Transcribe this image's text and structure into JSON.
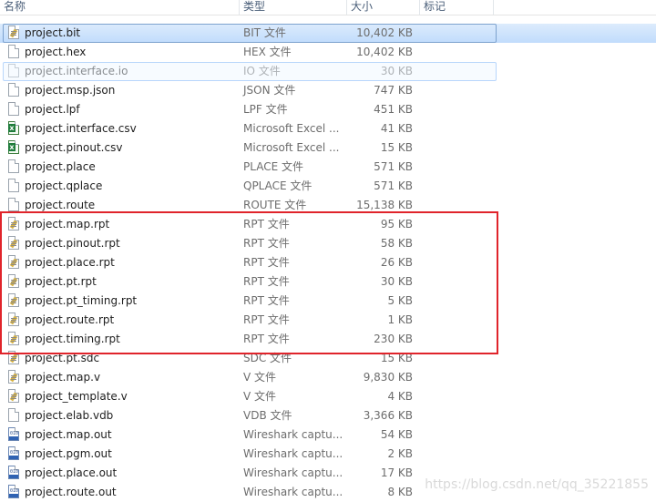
{
  "columns": {
    "name": "名称",
    "type": "类型",
    "size": "大小",
    "tags": "标记"
  },
  "files": [
    {
      "name": "project.bit",
      "type": "BIT 文件",
      "size": "10,402 KB",
      "icon": "document-icon"
    },
    {
      "name": "project.hex",
      "type": "HEX 文件",
      "size": "10,402 KB",
      "icon": "blank-file-icon"
    },
    {
      "name": "project.interface.io",
      "type": "IO 文件",
      "size": "30 KB",
      "icon": "blank-file-icon"
    },
    {
      "name": "project.msp.json",
      "type": "JSON 文件",
      "size": "747 KB",
      "icon": "blank-file-icon"
    },
    {
      "name": "project.lpf",
      "type": "LPF 文件",
      "size": "451 KB",
      "icon": "blank-file-icon"
    },
    {
      "name": "project.interface.csv",
      "type": "Microsoft Excel ...",
      "size": "41 KB",
      "icon": "excel-file-icon"
    },
    {
      "name": "project.pinout.csv",
      "type": "Microsoft Excel ...",
      "size": "15 KB",
      "icon": "excel-file-icon"
    },
    {
      "name": "project.place",
      "type": "PLACE 文件",
      "size": "571 KB",
      "icon": "blank-file-icon"
    },
    {
      "name": "project.qplace",
      "type": "QPLACE 文件",
      "size": "571 KB",
      "icon": "blank-file-icon"
    },
    {
      "name": "project.route",
      "type": "ROUTE 文件",
      "size": "15,138 KB",
      "icon": "blank-file-icon"
    },
    {
      "name": "project.map.rpt",
      "type": "RPT 文件",
      "size": "95 KB",
      "icon": "document-icon"
    },
    {
      "name": "project.pinout.rpt",
      "type": "RPT 文件",
      "size": "58 KB",
      "icon": "document-icon"
    },
    {
      "name": "project.place.rpt",
      "type": "RPT 文件",
      "size": "26 KB",
      "icon": "document-icon"
    },
    {
      "name": "project.pt.rpt",
      "type": "RPT 文件",
      "size": "30 KB",
      "icon": "document-icon"
    },
    {
      "name": "project.pt_timing.rpt",
      "type": "RPT 文件",
      "size": "5 KB",
      "icon": "document-icon"
    },
    {
      "name": "project.route.rpt",
      "type": "RPT 文件",
      "size": "1 KB",
      "icon": "document-icon"
    },
    {
      "name": "project.timing.rpt",
      "type": "RPT 文件",
      "size": "230 KB",
      "icon": "document-icon"
    },
    {
      "name": "project.pt.sdc",
      "type": "SDC 文件",
      "size": "15 KB",
      "icon": "document-icon"
    },
    {
      "name": "project.map.v",
      "type": "V 文件",
      "size": "9,830 KB",
      "icon": "document-icon"
    },
    {
      "name": "project_template.v",
      "type": "V 文件",
      "size": "4 KB",
      "icon": "document-icon"
    },
    {
      "name": "project.elab.vdb",
      "type": "VDB 文件",
      "size": "3,366 KB",
      "icon": "blank-file-icon"
    },
    {
      "name": "project.map.out",
      "type": "Wireshark captu...",
      "size": "54 KB",
      "icon": "wireshark-file-icon"
    },
    {
      "name": "project.pgm.out",
      "type": "Wireshark captu...",
      "size": "2 KB",
      "icon": "wireshark-file-icon"
    },
    {
      "name": "project.place.out",
      "type": "Wireshark captu...",
      "size": "17 KB",
      "icon": "wireshark-file-icon"
    },
    {
      "name": "project.route.out",
      "type": "Wireshark captu...",
      "size": "8 KB",
      "icon": "wireshark-file-icon"
    }
  ],
  "selected_file": "project.bit",
  "hovered_file": "project.interface.io",
  "annotation_color": "#e0242b",
  "watermark": "https://blog.csdn.net/qq_35221855"
}
